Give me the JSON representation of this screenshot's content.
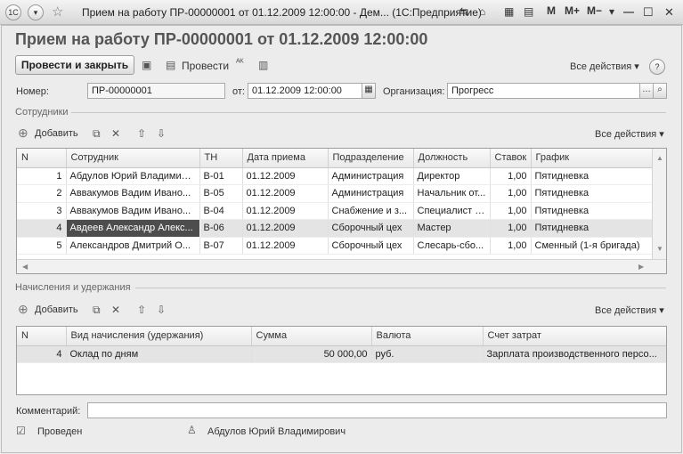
{
  "window": {
    "title": "Прием на работу ПР-00000001 от 01.12.2009 12:00:00 - Дем... (1С:Предприятие)",
    "logo": "1С",
    "memory_buttons": [
      "M",
      "M+",
      "M−"
    ]
  },
  "document": {
    "title": "Прием на работу ПР-00000001 от 01.12.2009 12:00:00"
  },
  "toolbar": {
    "post_close_label": "Провести и закрыть",
    "post_label": "Провести",
    "all_actions_label": "Все действия ▾",
    "help_label": "?"
  },
  "header_fields": {
    "number_label": "Номер:",
    "number_value": "ПР-00000001",
    "date_label": "от:",
    "date_value": "01.12.2009 12:00:00",
    "org_label": "Организация:",
    "org_value": "Прогресс"
  },
  "employees": {
    "section_title": "Сотрудники",
    "add_label": "Добавить",
    "all_actions_label": "Все действия ▾",
    "columns": [
      "N",
      "Сотрудник",
      "ТН",
      "Дата приема",
      "Подразделение",
      "Должность",
      "Ставок",
      "График"
    ],
    "rows": [
      [
        "1",
        "Абдулов Юрий Владимиро...",
        "В-01",
        "01.12.2009",
        "Администрация",
        "Директор",
        "1,00",
        "Пятидневка"
      ],
      [
        "2",
        "Аввакумов Вадим Ивано...",
        "В-05",
        "01.12.2009",
        "Администрация",
        "Начальник от...",
        "1,00",
        "Пятидневка"
      ],
      [
        "3",
        "Аввакумов Вадим Ивано...",
        "В-04",
        "01.12.2009",
        "Снабжение и з...",
        "Специалист п...",
        "1,00",
        "Пятидневка"
      ],
      [
        "4",
        "Авдеев Александр Алекс...",
        "В-06",
        "01.12.2009",
        "Сборочный цех",
        "Мастер",
        "1,00",
        "Пятидневка"
      ],
      [
        "5",
        "Александров Дмитрий О...",
        "В-07",
        "01.12.2009",
        "Сборочный цех",
        "Слесарь-сбо...",
        "1,00",
        "Сменный (1-я бригада)"
      ]
    ],
    "selected_row": 4
  },
  "accruals": {
    "section_title": "Начисления и удержания",
    "add_label": "Добавить",
    "all_actions_label": "Все действия ▾",
    "columns": [
      "N",
      "Вид начисления (удержания)",
      "Сумма",
      "Валюта",
      "Счет затрат"
    ],
    "rows": [
      [
        "4",
        "Оклад по дням",
        "50 000,00",
        "руб.",
        "Зарплата производственного персо..."
      ]
    ]
  },
  "footer": {
    "comment_label": "Комментарий:",
    "comment_value": "",
    "status_label": "Проведен",
    "author_name": "Абдулов Юрий Владимирович"
  }
}
